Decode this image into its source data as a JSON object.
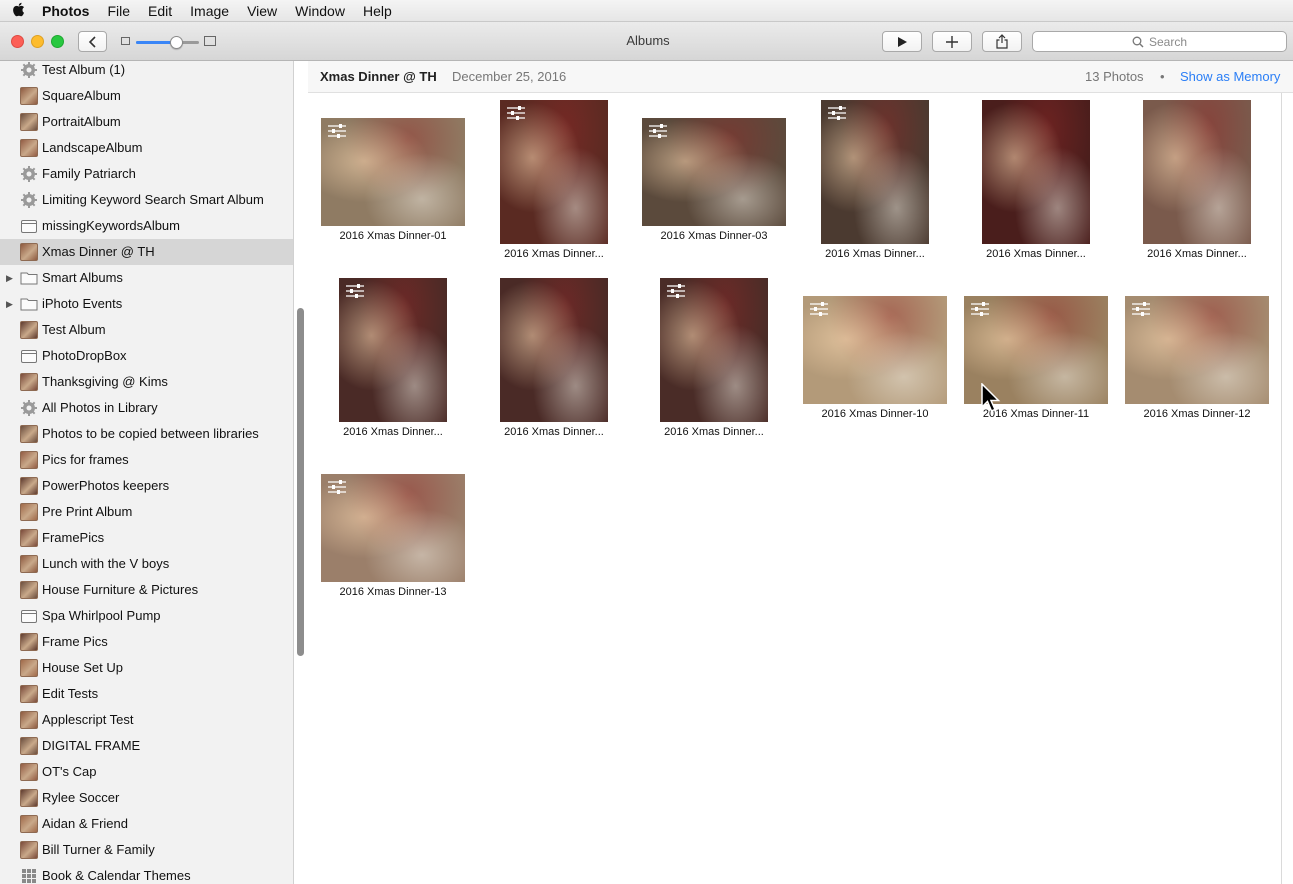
{
  "menubar": {
    "app": "Photos",
    "items": [
      "File",
      "Edit",
      "Image",
      "View",
      "Window",
      "Help"
    ]
  },
  "toolbar": {
    "title": "Albums",
    "search_placeholder": "Search"
  },
  "sidebar": {
    "items": [
      {
        "label": "Test Album (1)",
        "icon": "gear-icon"
      },
      {
        "label": "SquareAlbum",
        "icon": "photo-icon"
      },
      {
        "label": "PortraitAlbum",
        "icon": "photo-icon"
      },
      {
        "label": "LandscapeAlbum",
        "icon": "photo-icon"
      },
      {
        "label": "Family Patriarch",
        "icon": "gear-icon"
      },
      {
        "label": "Limiting Keyword Search Smart Album",
        "icon": "gear-icon"
      },
      {
        "label": "missingKeywordsAlbum",
        "icon": "album-icon"
      },
      {
        "label": "Xmas Dinner @ TH",
        "icon": "photo-icon",
        "selected": true
      },
      {
        "label": "Smart Albums",
        "icon": "folder-icon",
        "folder": true
      },
      {
        "label": "iPhoto Events",
        "icon": "folder-icon",
        "folder": true
      },
      {
        "label": "Test Album",
        "icon": "photo-icon"
      },
      {
        "label": "PhotoDropBox",
        "icon": "album-icon"
      },
      {
        "label": "Thanksgiving @ Kims",
        "icon": "photo-icon"
      },
      {
        "label": "All Photos in Library",
        "icon": "gear-icon"
      },
      {
        "label": "Photos to be copied between libraries",
        "icon": "photo-icon"
      },
      {
        "label": "Pics for frames",
        "icon": "photo-icon"
      },
      {
        "label": "PowerPhotos keepers",
        "icon": "photo-icon"
      },
      {
        "label": "Pre Print Album",
        "icon": "photo-icon"
      },
      {
        "label": "FramePics",
        "icon": "photo-icon"
      },
      {
        "label": "Lunch with the V boys",
        "icon": "photo-icon"
      },
      {
        "label": "House Furniture & Pictures",
        "icon": "photo-icon"
      },
      {
        "label": "Spa Whirlpool Pump",
        "icon": "album-icon"
      },
      {
        "label": "Frame Pics",
        "icon": "photo-icon"
      },
      {
        "label": "House Set Up",
        "icon": "photo-icon"
      },
      {
        "label": "Edit Tests",
        "icon": "photo-icon"
      },
      {
        "label": "Applescript Test",
        "icon": "photo-icon"
      },
      {
        "label": "DIGITAL FRAME",
        "icon": "photo-icon"
      },
      {
        "label": "OT's Cap",
        "icon": "photo-icon"
      },
      {
        "label": "Rylee Soccer",
        "icon": "photo-icon"
      },
      {
        "label": "Aidan & Friend",
        "icon": "photo-icon"
      },
      {
        "label": "Bill Turner & Family",
        "icon": "photo-icon"
      },
      {
        "label": "Book & Calendar Themes",
        "icon": "grid-icon"
      }
    ]
  },
  "album": {
    "title": "Xmas Dinner @ TH",
    "date": "December 25, 2016",
    "count": "13 Photos",
    "separator": "•",
    "memory_link": "Show as Memory"
  },
  "photos": [
    {
      "caption": "2016 Xmas Dinner-01",
      "color": "#8f7b63",
      "adjusted": true
    },
    {
      "caption": "2016 Xmas Dinner...",
      "color": "#5a2a22",
      "adjusted": true
    },
    {
      "caption": "2016 Xmas Dinner-03",
      "color": "#5b4a3c",
      "adjusted": true
    },
    {
      "caption": "2016 Xmas Dinner...",
      "color": "#4b3a30",
      "adjusted": true
    },
    {
      "caption": "2016 Xmas Dinner...",
      "color": "#4a1e1c",
      "adjusted": false
    },
    {
      "caption": "2016 Xmas Dinner...",
      "color": "#7a5a4c",
      "adjusted": false
    },
    {
      "caption": "2016 Xmas Dinner...",
      "color": "#4a2a26",
      "adjusted": true
    },
    {
      "caption": "2016 Xmas Dinner...",
      "color": "#4a2a26",
      "adjusted": false
    },
    {
      "caption": "2016 Xmas Dinner...",
      "color": "#4a2c27",
      "adjusted": true
    },
    {
      "caption": "2016 Xmas Dinner-10",
      "color": "#b39a79",
      "adjusted": true
    },
    {
      "caption": "2016 Xmas Dinner-11",
      "color": "#9a8160",
      "adjusted": true
    },
    {
      "caption": "2016 Xmas Dinner-12",
      "color": "#a58c70",
      "adjusted": true
    },
    {
      "caption": "2016 Xmas Dinner-13",
      "color": "#9b7f6a",
      "adjusted": true
    }
  ]
}
